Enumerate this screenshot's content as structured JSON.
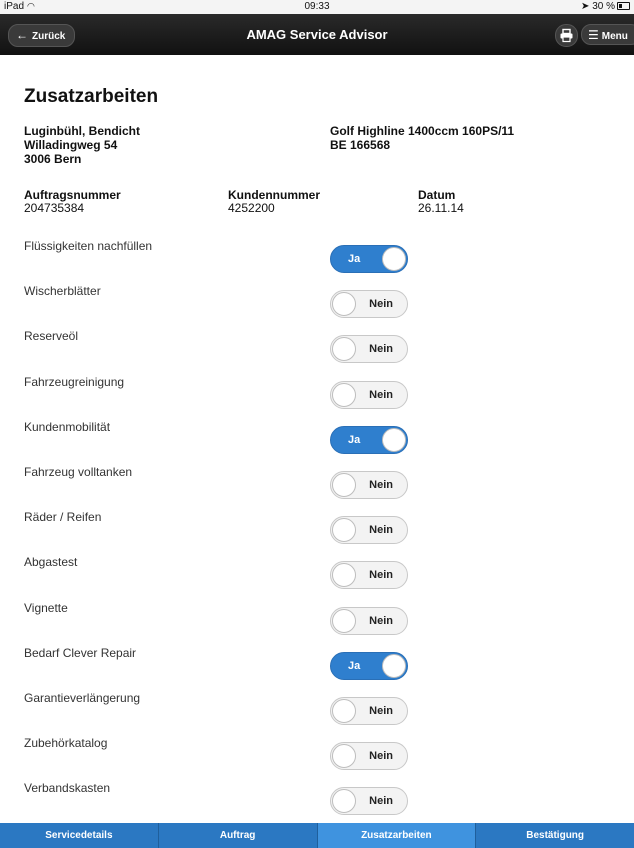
{
  "status_bar": {
    "device": "iPad",
    "time": "09:33",
    "battery": "30 %"
  },
  "header": {
    "title": "AMAG Service Advisor",
    "back_label": "Zurück",
    "menu_label": "Menu"
  },
  "page": {
    "title": "Zusatzarbeiten"
  },
  "customer": {
    "name": "Luginbühl, Bendicht",
    "street": "Willadingweg 54",
    "city": "3006 Bern"
  },
  "vehicle": {
    "model": "Golf Highline 1400ccm 160PS/11",
    "plate": "BE 166568"
  },
  "meta": [
    {
      "label": "Auftragsnummer",
      "value": "204735384"
    },
    {
      "label": "Kundennummer",
      "value": "4252200"
    },
    {
      "label": "Datum",
      "value": "26.11.14"
    }
  ],
  "options": [
    {
      "label": "Flüssigkeiten nachfüllen",
      "state": "Ja",
      "on": true
    },
    {
      "label": "Wischerblätter",
      "state": "Nein",
      "on": false
    },
    {
      "label": "Reserveöl",
      "state": "Nein",
      "on": false
    },
    {
      "label": "Fahrzeugreinigung",
      "state": "Nein",
      "on": false
    },
    {
      "label": "Kundenmobilität",
      "state": "Ja",
      "on": true
    },
    {
      "label": "Fahrzeug volltanken",
      "state": "Nein",
      "on": false
    },
    {
      "label": "Räder / Reifen",
      "state": "Nein",
      "on": false
    },
    {
      "label": "Abgastest",
      "state": "Nein",
      "on": false
    },
    {
      "label": "Vignette",
      "state": "Nein",
      "on": false
    },
    {
      "label": "Bedarf Clever Repair",
      "state": "Ja",
      "on": true
    },
    {
      "label": "Garantieverlängerung",
      "state": "Nein",
      "on": false
    },
    {
      "label": "Zubehörkatalog",
      "state": "Nein",
      "on": false
    },
    {
      "label": "Verbandskasten",
      "state": "Nein",
      "on": false
    }
  ],
  "tabs": [
    {
      "label": "Servicedetails",
      "active": false
    },
    {
      "label": "Auftrag",
      "active": false
    },
    {
      "label": "Zusatzarbeiten",
      "active": true
    },
    {
      "label": "Bestätigung",
      "active": false
    }
  ]
}
